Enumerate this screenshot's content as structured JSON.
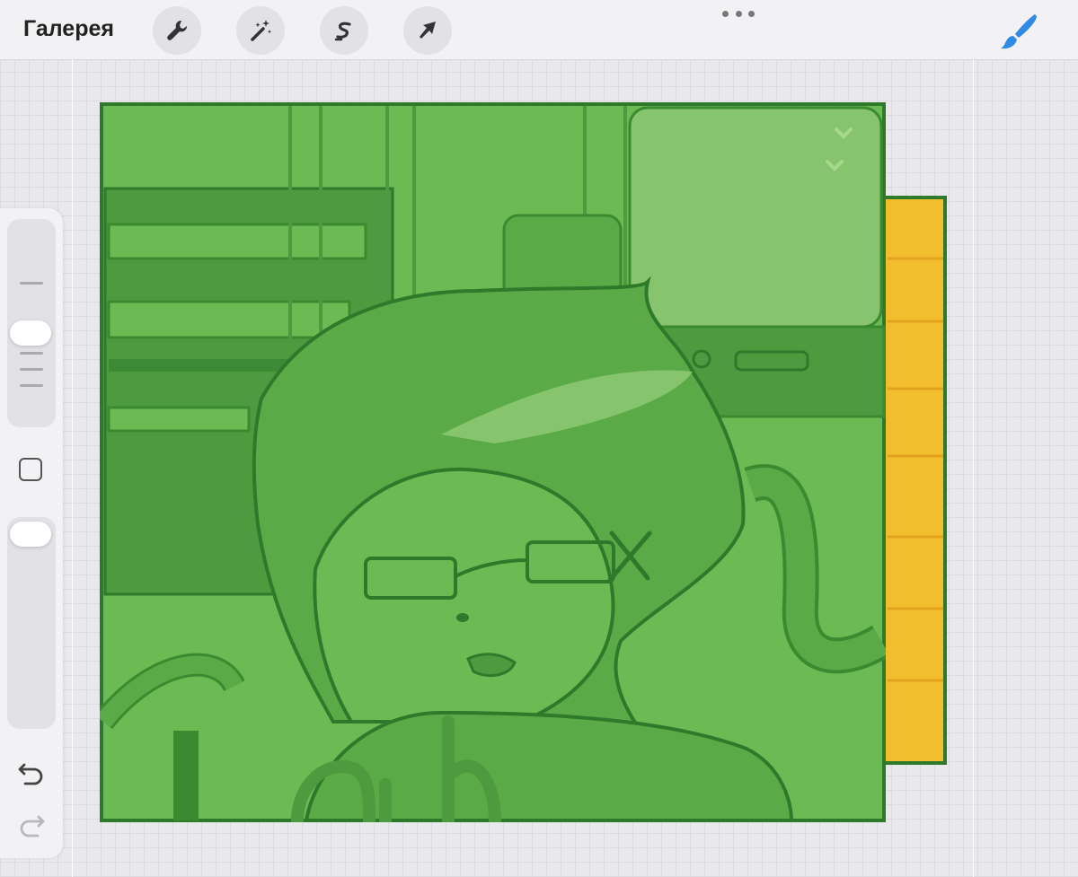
{
  "toolbar": {
    "gallery_label": "Галерея",
    "tools": [
      {
        "name": "actions",
        "icon": "wrench-icon"
      },
      {
        "name": "adjustments",
        "icon": "magic-wand-icon"
      },
      {
        "name": "selection",
        "icon": "selection-s-icon"
      },
      {
        "name": "transform",
        "icon": "arrow-cursor-icon"
      }
    ],
    "more_icon": "more-dots-icon",
    "brush_icon": "paintbrush-icon"
  },
  "sidebar": {
    "brush_size_icon": "brush-size-slider",
    "opacity_icon": "opacity-slider",
    "modify_icon": "square-modify-icon",
    "undo_icon": "undo-icon",
    "redo_icon": "redo-icon"
  },
  "colors": {
    "accent": "#2f8be6",
    "canvas_green": "#6cba54",
    "line_green": "#2f7a2a",
    "strip_yellow": "#f2be2e"
  }
}
